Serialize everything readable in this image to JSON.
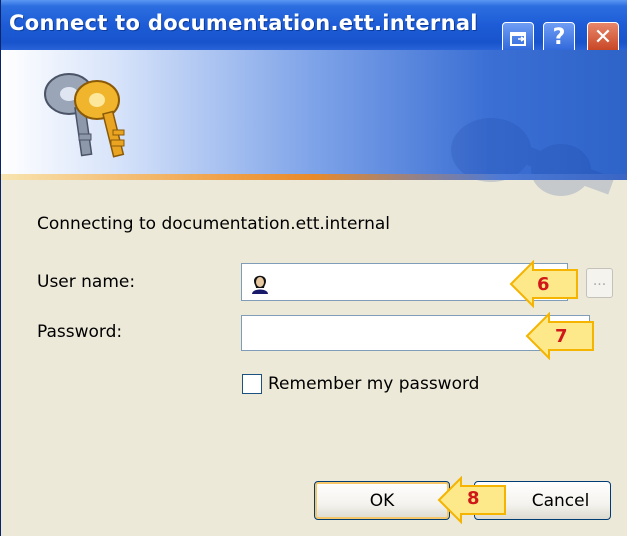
{
  "window": {
    "title": "Connect to documentation.ett.internal",
    "buttons": {
      "restore": "",
      "help": "?",
      "close": "✕"
    }
  },
  "content": {
    "connecting_text": "Connecting to documentation.ett.internal",
    "username_label": "User name:",
    "username_value": "",
    "password_label": "Password:",
    "password_value": "",
    "ellipsis_label": "...",
    "remember_label": "Remember my password",
    "remember_checked": false
  },
  "buttons": {
    "ok": "OK",
    "cancel": "Cancel"
  },
  "callouts": [
    "6",
    "7",
    "8"
  ],
  "colors": {
    "titlebar": "#1d5cd6",
    "dialog_bg": "#ece9d8",
    "callout_fill": "#fde98a",
    "callout_number": "#d01818"
  },
  "icons": [
    "keys-icon",
    "restore-icon",
    "help-icon",
    "close-icon",
    "user-avatar-icon"
  ]
}
